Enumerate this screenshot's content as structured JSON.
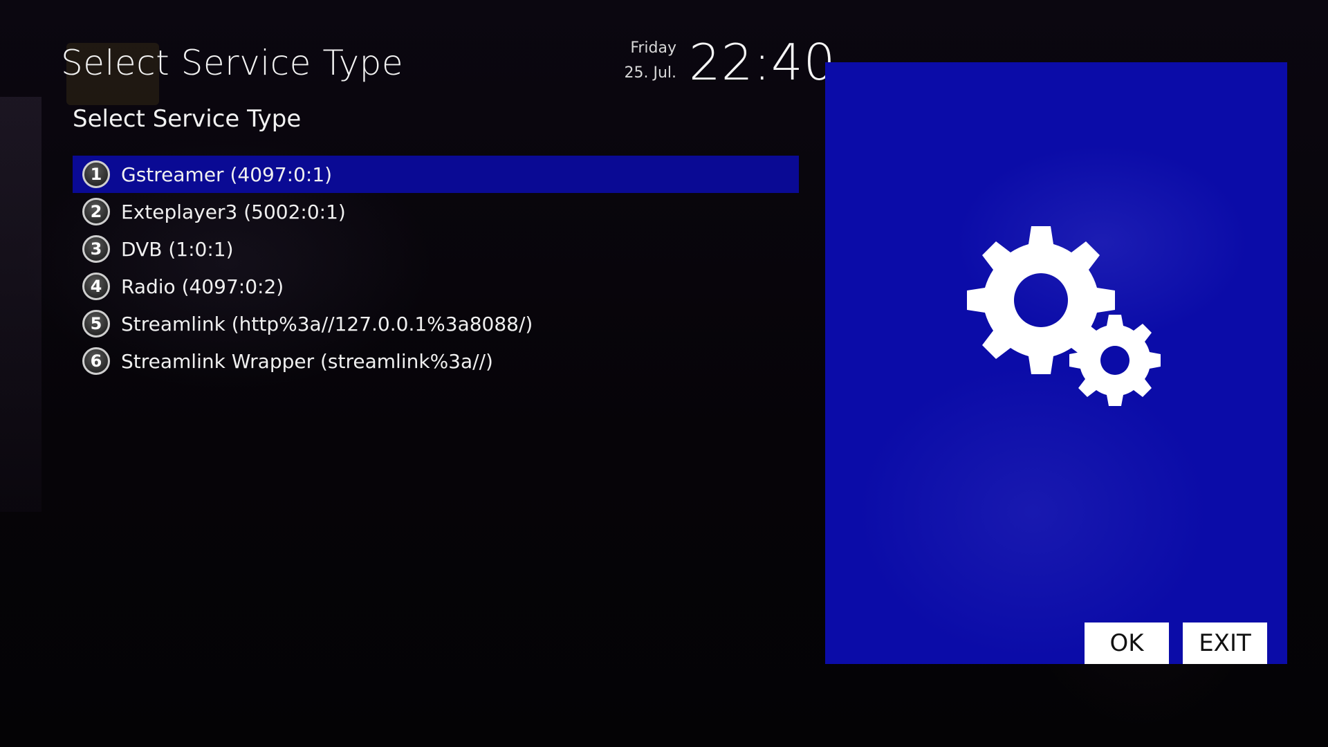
{
  "window": {
    "title": "Select Service Type"
  },
  "clock": {
    "day": "Friday",
    "date": "25. Jul.",
    "time": "22:40"
  },
  "list": {
    "header": "Select Service Type",
    "selected_index": 0,
    "items": [
      {
        "number": "1",
        "label": "Gstreamer (4097:0:1)"
      },
      {
        "number": "2",
        "label": "Exteplayer3 (5002:0:1)"
      },
      {
        "number": "3",
        "label": "DVB (1:0:1)"
      },
      {
        "number": "4",
        "label": "Radio (4097:0:2)"
      },
      {
        "number": "5",
        "label": "Streamlink (http%3a//127.0.0.1%3a8088/)"
      },
      {
        "number": "6",
        "label": "Streamlink Wrapper (streamlink%3a//)"
      }
    ]
  },
  "info_panel": {
    "icon": "settings-gears-icon"
  },
  "buttons": {
    "ok_label": "OK",
    "exit_label": "EXIT"
  },
  "colors": {
    "selection": "#0a0a94",
    "panel": "#0b0ca8",
    "background": "#07050a"
  }
}
